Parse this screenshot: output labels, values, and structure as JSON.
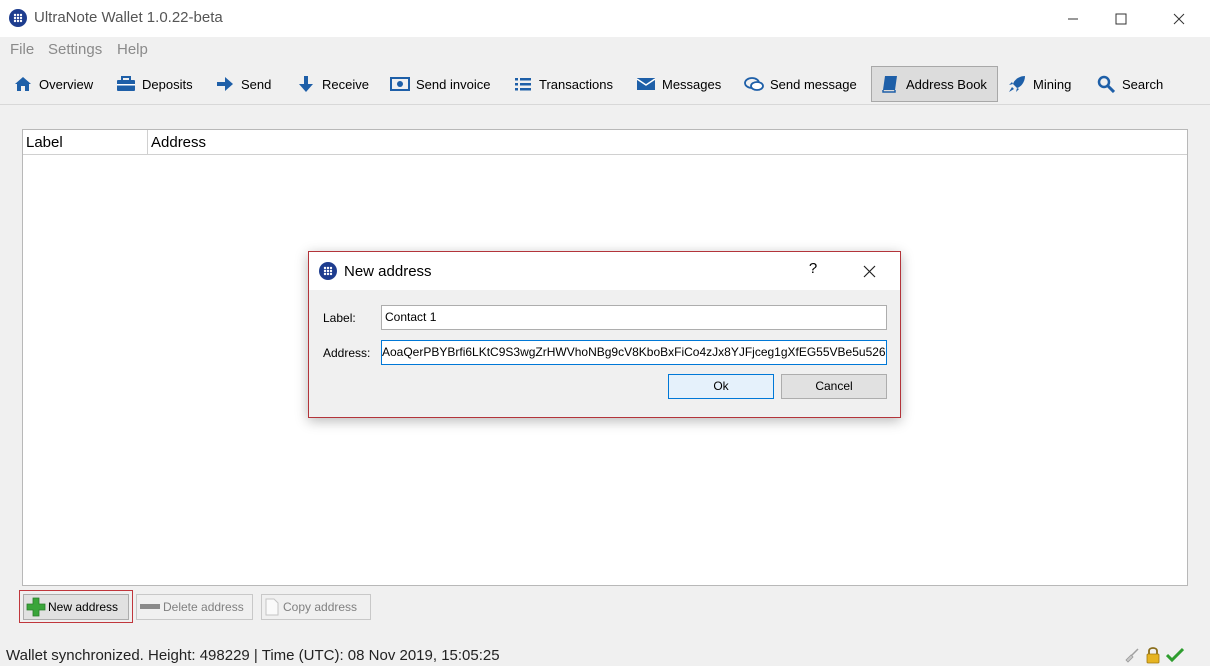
{
  "window": {
    "title": "UltraNote Wallet 1.0.22-beta",
    "controls": [
      "minimize-icon",
      "maximize-icon",
      "close-icon"
    ]
  },
  "menu": {
    "file": "File",
    "settings": "Settings",
    "help": "Help"
  },
  "toolbar": {
    "overview": "Overview",
    "deposits": "Deposits",
    "send": "Send",
    "receive": "Receive",
    "send_invoice": "Send invoice",
    "transactions": "Transactions",
    "messages": "Messages",
    "send_message": "Send message",
    "address_book": "Address Book",
    "mining": "Mining",
    "search": "Search",
    "active": "Address Book",
    "icon_color": "#1e5fa8"
  },
  "table": {
    "columns": [
      "Label",
      "Address"
    ],
    "rows": []
  },
  "dialog": {
    "title": "New address",
    "help": "?",
    "label_caption": "Label:",
    "label_value": "Contact 1",
    "address_caption": "Address:",
    "address_value": "AoaQerPBYBrfi6LKtC9S3wgZrHWVhoNBg9cV8KboBxFiCo4zJx8YJFjceg1gXfEG55VBe5u526",
    "ok": "Ok",
    "cancel": "Cancel"
  },
  "actions": {
    "new_address": "New address",
    "delete_address": "Delete address",
    "copy_address": "Copy address"
  },
  "status": {
    "text": "Wallet synchronized. Height: 498229  |  Time (UTC): 08 Nov 2019, 15:05:25",
    "icons": [
      "broom-icon",
      "lock-icon",
      "checkmark-icon"
    ]
  },
  "colors": {
    "accent": "#1e5fa8",
    "highlight_border": "#c0363c",
    "success": "#2e9d2e"
  }
}
